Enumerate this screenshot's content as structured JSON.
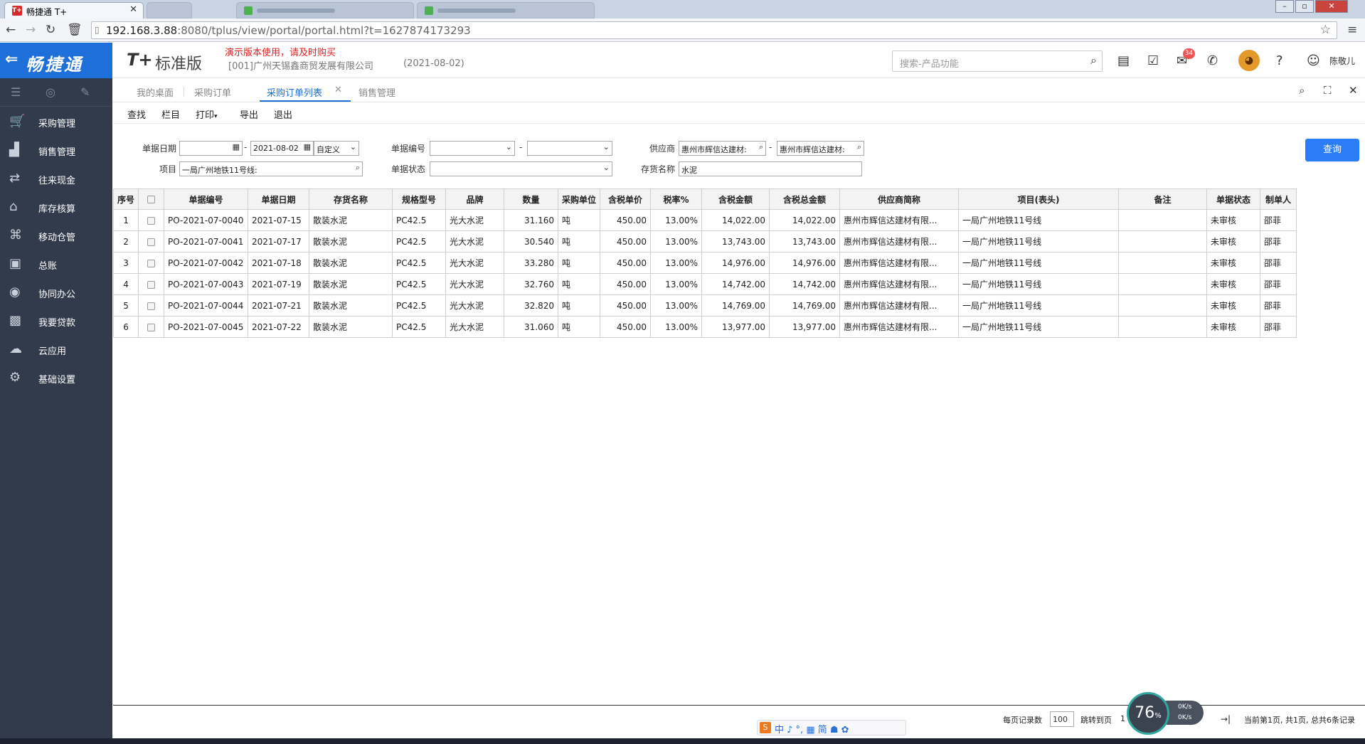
{
  "browser": {
    "tab_title": "畅捷通 T+",
    "url_host": "192.168.3.88",
    "url_rest": ":8080/tplus/view/portal/portal.html?t=1627874173293"
  },
  "header": {
    "logo_text": "畅捷通",
    "edition_mark": "T+",
    "edition_name": "标准版",
    "demo_notice": "演示版本使用，请及时购买",
    "company": "[001]广州天锡鑫商贸发展有限公司",
    "date": "(2021-08-02)",
    "search_placeholder": "搜索-产品功能",
    "notify_count": "34",
    "username": "陈敬儿"
  },
  "sidebar": {
    "items": [
      {
        "label": "采购管理",
        "icon": "cart-icon"
      },
      {
        "label": "销售管理",
        "icon": "chart-icon"
      },
      {
        "label": "往来现金",
        "icon": "cash-icon"
      },
      {
        "label": "库存核算",
        "icon": "warehouse-icon"
      },
      {
        "label": "移动仓管",
        "icon": "mobile-warehouse-icon"
      },
      {
        "label": "总账",
        "icon": "ledger-icon"
      },
      {
        "label": "协同办公",
        "icon": "collab-icon"
      },
      {
        "label": "我要贷款",
        "icon": "loan-icon"
      },
      {
        "label": "云应用",
        "icon": "cloud-icon"
      },
      {
        "label": "基础设置",
        "icon": "settings-icon"
      }
    ]
  },
  "tabs": [
    {
      "label": "我的桌面"
    },
    {
      "label": "采购订单"
    },
    {
      "label": "采购订单列表"
    },
    {
      "label": "销售管理"
    }
  ],
  "toolbar": {
    "find": "查找",
    "columns": "栏目",
    "print": "打印",
    "export": "导出",
    "exit": "退出"
  },
  "filter": {
    "date_label": "单据日期",
    "date_from": "",
    "date_to": "2021-08-02",
    "date_mode": "自定义",
    "code_label": "单据编号",
    "supplier_label": "供应商",
    "supplier_from": "惠州市辉信达建材:",
    "supplier_to": "惠州市辉信达建材:",
    "project_label": "项目",
    "project_value": "一局广州地铁11号线:",
    "status_label": "单据状态",
    "item_label": "存货名称",
    "item_value": "水泥",
    "dash": "-",
    "query_button": "查询"
  },
  "table": {
    "headers": [
      "序号",
      "",
      "单据编号",
      "单据日期",
      "存货名称",
      "规格型号",
      "品牌",
      "数量",
      "采购单位",
      "含税单价",
      "税率%",
      "含税金额",
      "含税总金额",
      "供应商简称",
      "项目(表头)",
      "备注",
      "单据状态",
      "制单人"
    ],
    "rows": [
      [
        "1",
        "PO-2021-07-0040",
        "2021-07-15",
        "散装水泥",
        "PC42.5",
        "光大水泥",
        "31.160",
        "吨",
        "450.00",
        "13.00%",
        "14,022.00",
        "14,022.00",
        "惠州市辉信达建材有限...",
        "一局广州地铁11号线",
        "",
        "未审核",
        "邵菲"
      ],
      [
        "2",
        "PO-2021-07-0041",
        "2021-07-17",
        "散装水泥",
        "PC42.5",
        "光大水泥",
        "30.540",
        "吨",
        "450.00",
        "13.00%",
        "13,743.00",
        "13,743.00",
        "惠州市辉信达建材有限...",
        "一局广州地铁11号线",
        "",
        "未审核",
        "邵菲"
      ],
      [
        "3",
        "PO-2021-07-0042",
        "2021-07-18",
        "散装水泥",
        "PC42.5",
        "光大水泥",
        "33.280",
        "吨",
        "450.00",
        "13.00%",
        "14,976.00",
        "14,976.00",
        "惠州市辉信达建材有限...",
        "一局广州地铁11号线",
        "",
        "未审核",
        "邵菲"
      ],
      [
        "4",
        "PO-2021-07-0043",
        "2021-07-19",
        "散装水泥",
        "PC42.5",
        "光大水泥",
        "32.760",
        "吨",
        "450.00",
        "13.00%",
        "14,742.00",
        "14,742.00",
        "惠州市辉信达建材有限...",
        "一局广州地铁11号线",
        "",
        "未审核",
        "邵菲"
      ],
      [
        "5",
        "PO-2021-07-0044",
        "2021-07-21",
        "散装水泥",
        "PC42.5",
        "光大水泥",
        "32.820",
        "吨",
        "450.00",
        "13.00%",
        "14,769.00",
        "14,769.00",
        "惠州市辉信达建材有限...",
        "一局广州地铁11号线",
        "",
        "未审核",
        "邵菲"
      ],
      [
        "6",
        "PO-2021-07-0045",
        "2021-07-22",
        "散装水泥",
        "PC42.5",
        "光大水泥",
        "31.060",
        "吨",
        "450.00",
        "13.00%",
        "13,977.00",
        "13,977.00",
        "惠州市辉信达建材有限...",
        "一局广州地铁11号线",
        "",
        "未审核",
        "邵菲"
      ]
    ]
  },
  "pager": {
    "per_page_label": "每页记录数",
    "per_page": "100",
    "jump_label": "跳转到页",
    "jump_value": "1",
    "summary": "当前第1页, 共1页, 总共6条记录"
  },
  "overlay": {
    "speed_value": "76",
    "speed_unit": "%",
    "net_up": "0K/s",
    "net_down": "0K/s",
    "ime_text": "中 ♪ °, ▦ 简 ☗ ✿",
    "ime_logo": "S"
  },
  "colors": {
    "accent": "#1e6fd9",
    "sidebar": "#323b4b",
    "alert": "#e02020"
  }
}
